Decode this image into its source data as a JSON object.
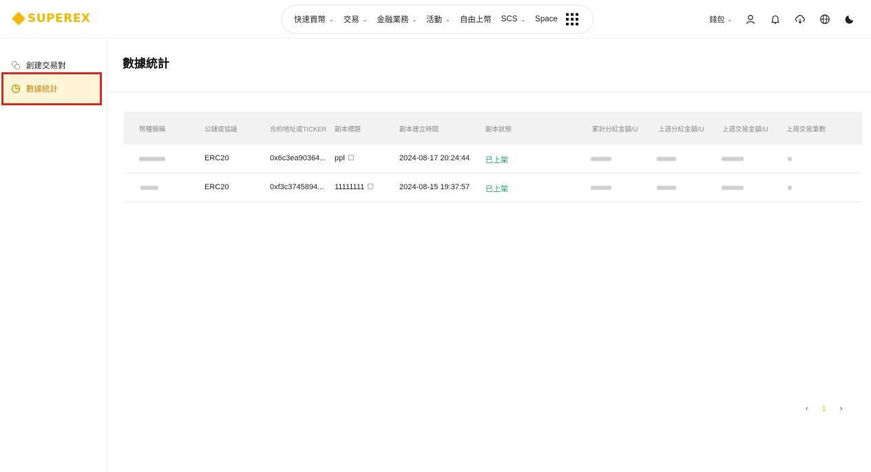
{
  "brand": {
    "name": "SUPEREX",
    "color": "#f5b800"
  },
  "nav": {
    "items": [
      {
        "label": "快速買幣",
        "has_dropdown": true
      },
      {
        "label": "交易",
        "has_dropdown": true
      },
      {
        "label": "金融業務",
        "has_dropdown": true
      },
      {
        "label": "活動",
        "has_dropdown": true
      },
      {
        "label": "自由上幣",
        "has_dropdown": false
      },
      {
        "label": "SCS",
        "has_dropdown": true
      },
      {
        "label": "Space",
        "has_dropdown": false
      }
    ],
    "chevron": "⌄",
    "apps_icon": "grid-icon"
  },
  "header_right": {
    "wallet_label": "錢包",
    "icons": [
      "user-icon",
      "bell-icon",
      "download-icon",
      "globe-icon",
      "moon-icon"
    ]
  },
  "sidebar": {
    "items": [
      {
        "label": "創建交易對",
        "icon": "coins-icon",
        "active": false
      },
      {
        "label": "數據統計",
        "icon": "pie-chart-icon",
        "active": true
      }
    ]
  },
  "main": {
    "title": "數據統計",
    "table": {
      "headers": [
        "幣種簡稱",
        "公鏈或協議",
        "合約地址或TICKER",
        "副本標題",
        "副本建立時間",
        "副本狀態",
        "累計分紅金額/U",
        "上週分紅金額/U",
        "上週交易金額/U",
        "上周交易筆數"
      ],
      "rows": [
        {
          "chain": "ERC20",
          "contract": "0x6c3ea90364...",
          "title": "ppl",
          "created": "2024-08-17 20:24:44",
          "status": "已上架"
        },
        {
          "chain": "ERC20",
          "contract": "0xf3c3745894...",
          "title": "11111111",
          "created": "2024-08-15 19:37:57",
          "status": "已上架"
        }
      ]
    },
    "pagination": {
      "prev": "‹",
      "current": "1",
      "next": "›"
    }
  },
  "colors": {
    "accent": "#f5b800",
    "status_green": "#1aa860",
    "highlight_red": "#e3291d",
    "active_bg": "#fff4d6"
  }
}
